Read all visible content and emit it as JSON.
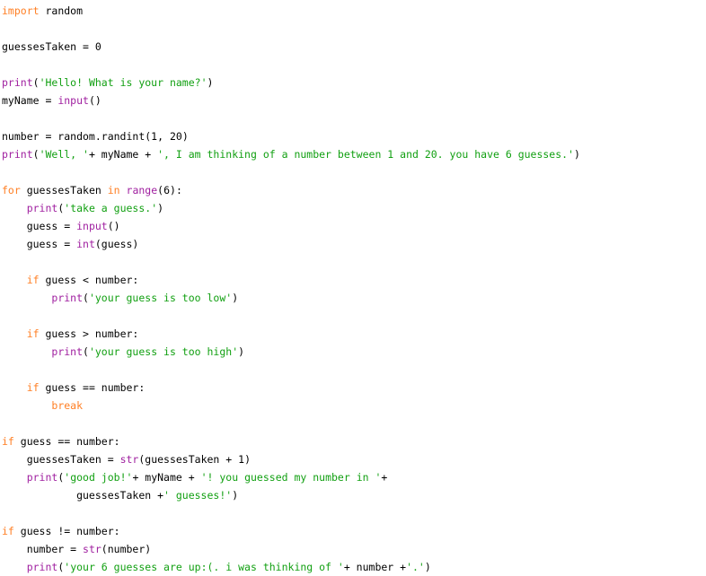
{
  "document": {
    "kind": "source-code-listing",
    "language": "Python",
    "background_color": "#ffffff",
    "font_kind": "monospace"
  },
  "theme": {
    "keyword_color": "#ff7f24",
    "builtin_color": "#a020a0",
    "string_color": "#12a012",
    "plain_color": "#000000",
    "background_color": "#ffffff"
  },
  "code": {
    "lines": [
      {
        "tokens": [
          {
            "t": "import",
            "k": "keyword"
          },
          {
            "t": " random",
            "k": "plain"
          }
        ]
      },
      {
        "tokens": []
      },
      {
        "tokens": [
          {
            "t": "guessesTaken = ",
            "k": "plain"
          },
          {
            "t": "0",
            "k": "number"
          }
        ]
      },
      {
        "tokens": []
      },
      {
        "tokens": [
          {
            "t": "print",
            "k": "builtin"
          },
          {
            "t": "(",
            "k": "punct"
          },
          {
            "t": "'Hello! What is your name?'",
            "k": "string"
          },
          {
            "t": ")",
            "k": "punct"
          }
        ]
      },
      {
        "tokens": [
          {
            "t": "myName = ",
            "k": "plain"
          },
          {
            "t": "input",
            "k": "builtin"
          },
          {
            "t": "()",
            "k": "punct"
          }
        ]
      },
      {
        "tokens": []
      },
      {
        "tokens": [
          {
            "t": "number = random.randint(",
            "k": "plain"
          },
          {
            "t": "1",
            "k": "number"
          },
          {
            "t": ", ",
            "k": "plain"
          },
          {
            "t": "20",
            "k": "number"
          },
          {
            "t": ")",
            "k": "punct"
          }
        ]
      },
      {
        "tokens": [
          {
            "t": "print",
            "k": "builtin"
          },
          {
            "t": "(",
            "k": "punct"
          },
          {
            "t": "'Well, '",
            "k": "string"
          },
          {
            "t": "+ myName + ",
            "k": "plain"
          },
          {
            "t": "', I am thinking of a number between 1 and 20. you have 6 guesses.'",
            "k": "string"
          },
          {
            "t": ")",
            "k": "punct"
          }
        ]
      },
      {
        "tokens": []
      },
      {
        "tokens": [
          {
            "t": "for",
            "k": "keyword"
          },
          {
            "t": " guessesTaken ",
            "k": "plain"
          },
          {
            "t": "in",
            "k": "keyword"
          },
          {
            "t": " ",
            "k": "plain"
          },
          {
            "t": "range",
            "k": "builtin"
          },
          {
            "t": "(",
            "k": "punct"
          },
          {
            "t": "6",
            "k": "number"
          },
          {
            "t": "):",
            "k": "punct"
          }
        ]
      },
      {
        "tokens": [
          {
            "t": "    ",
            "k": "plain"
          },
          {
            "t": "print",
            "k": "builtin"
          },
          {
            "t": "(",
            "k": "punct"
          },
          {
            "t": "'take a guess.'",
            "k": "string"
          },
          {
            "t": ")",
            "k": "punct"
          }
        ]
      },
      {
        "tokens": [
          {
            "t": "    guess = ",
            "k": "plain"
          },
          {
            "t": "input",
            "k": "builtin"
          },
          {
            "t": "()",
            "k": "punct"
          }
        ]
      },
      {
        "tokens": [
          {
            "t": "    guess = ",
            "k": "plain"
          },
          {
            "t": "int",
            "k": "builtin"
          },
          {
            "t": "(guess)",
            "k": "punct"
          }
        ]
      },
      {
        "tokens": []
      },
      {
        "tokens": [
          {
            "t": "    ",
            "k": "plain"
          },
          {
            "t": "if",
            "k": "keyword"
          },
          {
            "t": " guess < number:",
            "k": "plain"
          }
        ]
      },
      {
        "tokens": [
          {
            "t": "        ",
            "k": "plain"
          },
          {
            "t": "print",
            "k": "builtin"
          },
          {
            "t": "(",
            "k": "punct"
          },
          {
            "t": "'your guess is too low'",
            "k": "string"
          },
          {
            "t": ")",
            "k": "punct"
          }
        ]
      },
      {
        "tokens": []
      },
      {
        "tokens": [
          {
            "t": "    ",
            "k": "plain"
          },
          {
            "t": "if",
            "k": "keyword"
          },
          {
            "t": " guess > number:",
            "k": "plain"
          }
        ]
      },
      {
        "tokens": [
          {
            "t": "        ",
            "k": "plain"
          },
          {
            "t": "print",
            "k": "builtin"
          },
          {
            "t": "(",
            "k": "punct"
          },
          {
            "t": "'your guess is too high'",
            "k": "string"
          },
          {
            "t": ")",
            "k": "punct"
          }
        ]
      },
      {
        "tokens": []
      },
      {
        "tokens": [
          {
            "t": "    ",
            "k": "plain"
          },
          {
            "t": "if",
            "k": "keyword"
          },
          {
            "t": " guess == number:",
            "k": "plain"
          }
        ]
      },
      {
        "tokens": [
          {
            "t": "        ",
            "k": "plain"
          },
          {
            "t": "break",
            "k": "keyword"
          }
        ]
      },
      {
        "tokens": []
      },
      {
        "tokens": [
          {
            "t": "if",
            "k": "keyword"
          },
          {
            "t": " guess == number:",
            "k": "plain"
          }
        ]
      },
      {
        "tokens": [
          {
            "t": "    guessesTaken = ",
            "k": "plain"
          },
          {
            "t": "str",
            "k": "builtin"
          },
          {
            "t": "(guessesTaken + ",
            "k": "plain"
          },
          {
            "t": "1",
            "k": "number"
          },
          {
            "t": ")",
            "k": "punct"
          }
        ]
      },
      {
        "tokens": [
          {
            "t": "    ",
            "k": "plain"
          },
          {
            "t": "print",
            "k": "builtin"
          },
          {
            "t": "(",
            "k": "punct"
          },
          {
            "t": "'good job!'",
            "k": "string"
          },
          {
            "t": "+ myName + ",
            "k": "plain"
          },
          {
            "t": "'! you guessed my number in '",
            "k": "string"
          },
          {
            "t": "+",
            "k": "plain"
          }
        ]
      },
      {
        "tokens": [
          {
            "t": "            guessesTaken +",
            "k": "plain"
          },
          {
            "t": "' guesses!'",
            "k": "string"
          },
          {
            "t": ")",
            "k": "punct"
          }
        ]
      },
      {
        "tokens": []
      },
      {
        "tokens": [
          {
            "t": "if",
            "k": "keyword"
          },
          {
            "t": " guess != number:",
            "k": "plain"
          }
        ]
      },
      {
        "tokens": [
          {
            "t": "    number = ",
            "k": "plain"
          },
          {
            "t": "str",
            "k": "builtin"
          },
          {
            "t": "(number)",
            "k": "punct"
          }
        ]
      },
      {
        "tokens": [
          {
            "t": "    ",
            "k": "plain"
          },
          {
            "t": "print",
            "k": "builtin"
          },
          {
            "t": "(",
            "k": "punct"
          },
          {
            "t": "'your 6 guesses are up:(. i was thinking of '",
            "k": "string"
          },
          {
            "t": "+ number +",
            "k": "plain"
          },
          {
            "t": "'.'",
            "k": "string"
          },
          {
            "t": ")",
            "k": "punct"
          }
        ]
      }
    ]
  }
}
